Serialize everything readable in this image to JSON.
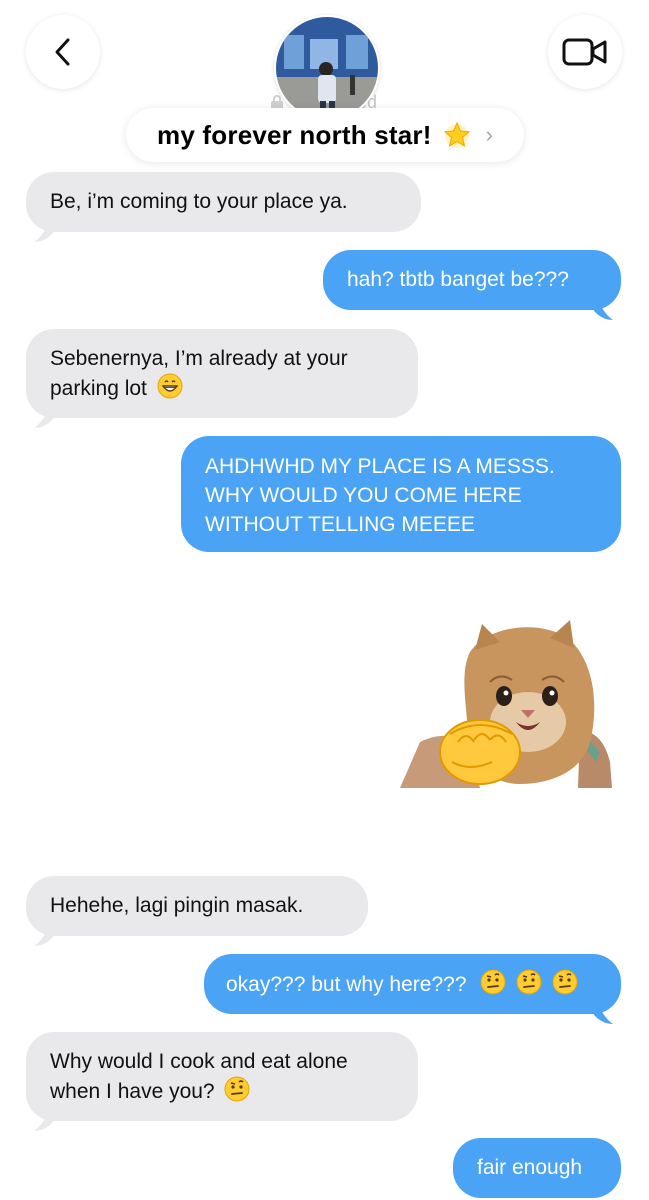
{
  "header": {
    "back_icon": "chevron-left-icon",
    "video_icon": "video-camera-icon",
    "contact_name": "my forever north star!",
    "star_icon": "glowing-star-icon",
    "chevron_icon": "chevron-right-icon",
    "ghost_status": "ed"
  },
  "messages": [
    {
      "side": "received",
      "lines": [
        "Be, i’m coming to your place ya."
      ]
    },
    {
      "side": "sent",
      "lines": [
        "hah? tbtb banget be???"
      ]
    },
    {
      "side": "received",
      "lines": [
        "Sebenernya, I’m already at your",
        "parking lot"
      ],
      "emoji": "grinning-face"
    },
    {
      "side": "sent",
      "lines": [
        "AHDHWHD MY PLACE IS A MESSS.",
        "WHY WOULD YOU COME HERE",
        "WITHOUT TELLING MEEEE"
      ]
    },
    {
      "side": "sent",
      "type": "sticker",
      "sticker": "kitten-fist-bump-sticker"
    },
    {
      "side": "received",
      "lines": [
        "Hehehe, lagi pingin masak."
      ]
    },
    {
      "side": "sent",
      "lines": [
        "okay??? but why here???"
      ],
      "emoji": "raised-eyebrow-face",
      "emoji_count": 3
    },
    {
      "side": "received",
      "lines": [
        "Why would I cook and eat alone",
        "when I have you?"
      ],
      "emoji": "raised-eyebrow-face"
    },
    {
      "side": "sent",
      "lines": [
        "fair enough"
      ]
    }
  ],
  "colors": {
    "sent": "#4aa3f5",
    "received": "#e9e9eb",
    "background": "#ffffff"
  }
}
